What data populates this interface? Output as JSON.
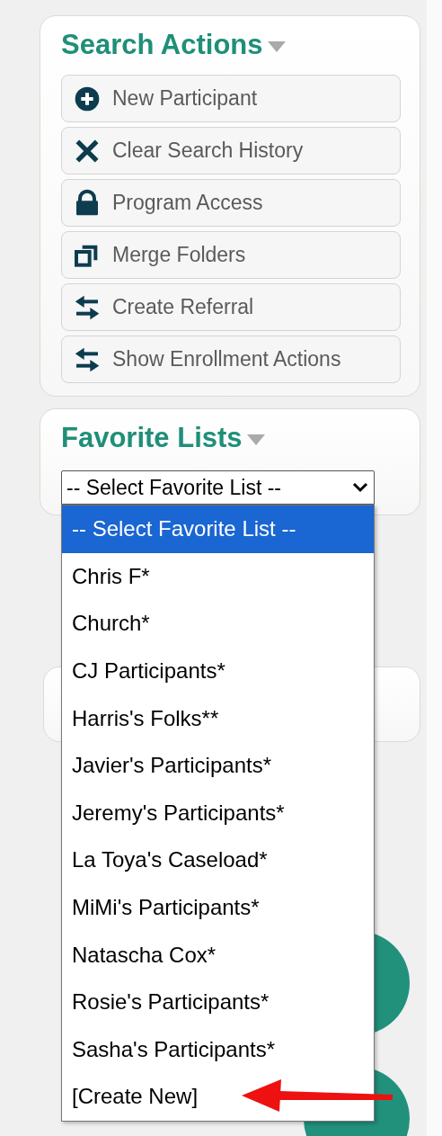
{
  "search_actions": {
    "title": "Search Actions",
    "buttons": [
      {
        "label": "New Participant",
        "kind": "add"
      },
      {
        "label": "Clear Search History",
        "kind": "clear"
      },
      {
        "label": "Program Access",
        "kind": "lock"
      },
      {
        "label": "Merge Folders",
        "kind": "merge"
      },
      {
        "label": "Create Referral",
        "kind": "transfer"
      },
      {
        "label": "Show Enrollment Actions",
        "kind": "transfer"
      }
    ]
  },
  "favorite_lists": {
    "title": "Favorite Lists",
    "select": {
      "value": "-- Select Favorite List --",
      "expanded": true
    },
    "options": [
      {
        "label": "-- Select Favorite List --",
        "selected": true
      },
      {
        "label": "Chris F*",
        "selected": false
      },
      {
        "label": "Church*",
        "selected": false
      },
      {
        "label": "CJ Participants*",
        "selected": false
      },
      {
        "label": "Harris's Folks**",
        "selected": false
      },
      {
        "label": "Javier's Participants*",
        "selected": false
      },
      {
        "label": "Jeremy's Participants*",
        "selected": false
      },
      {
        "label": "La Toya's Caseload*",
        "selected": false
      },
      {
        "label": "MiMi's Participants*",
        "selected": false
      },
      {
        "label": "Natascha Cox*",
        "selected": false
      },
      {
        "label": "Rosie's Participants*",
        "selected": false
      },
      {
        "label": "Sasha's Participants*",
        "selected": false
      },
      {
        "label": "[Create New]",
        "selected": false
      }
    ]
  }
}
